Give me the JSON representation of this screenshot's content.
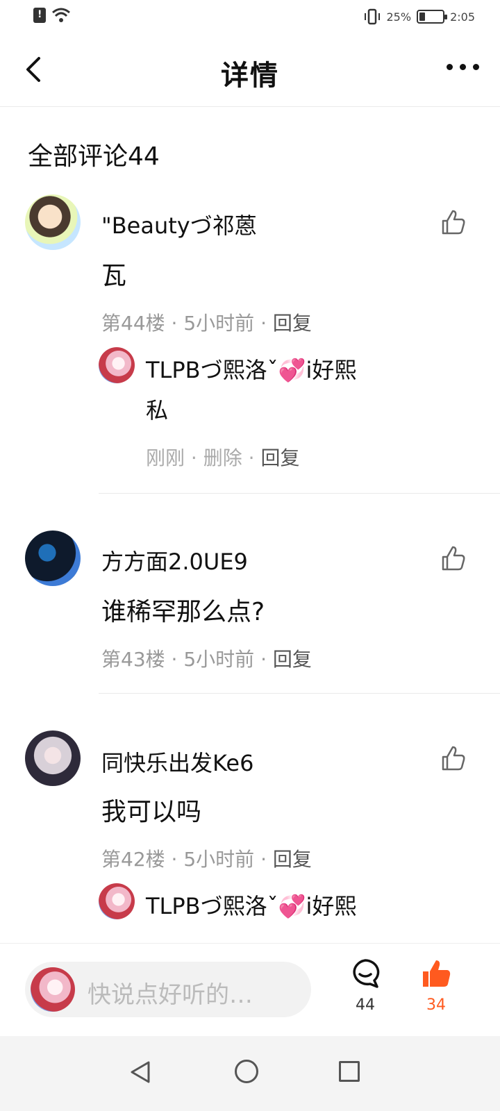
{
  "status_bar": {
    "battery_percent": "25%",
    "battery_level": 0.25,
    "time": "2:05"
  },
  "header": {
    "title": "详情"
  },
  "section": {
    "title": "全部评论44"
  },
  "comments": [
    {
      "username": "\"Beautyづ祁蒽",
      "content": "瓦",
      "floor": "第44楼",
      "time": "5小时前",
      "reply_label": "回复",
      "replies": [
        {
          "username": "TLPBづ熙洛ˇ💞i好熙",
          "content": "私",
          "time": "刚刚",
          "delete_label": "删除",
          "reply_label": "回复"
        }
      ]
    },
    {
      "username": "方方面2.0UE9",
      "content": "谁稀罕那么点?",
      "floor": "第43楼",
      "time": "5小时前",
      "reply_label": "回复"
    },
    {
      "username": "同快乐出发Ke6",
      "content": "我可以吗",
      "floor": "第42楼",
      "time": "5小时前",
      "reply_label": "回复",
      "replies": [
        {
          "username": "TLPBづ熙洛ˇ💞i好熙"
        }
      ]
    }
  ],
  "input_bar": {
    "placeholder": "快说点好听的…",
    "comment_count": "44",
    "like_count": "34"
  },
  "icons": {
    "back": "chevron-left-icon",
    "more": "more-dots-icon",
    "like": "thumbs-up-icon",
    "comment": "comment-bubble-icon"
  },
  "colors": {
    "accent_orange": "#ff5a1f",
    "meta_grey": "#999999"
  }
}
